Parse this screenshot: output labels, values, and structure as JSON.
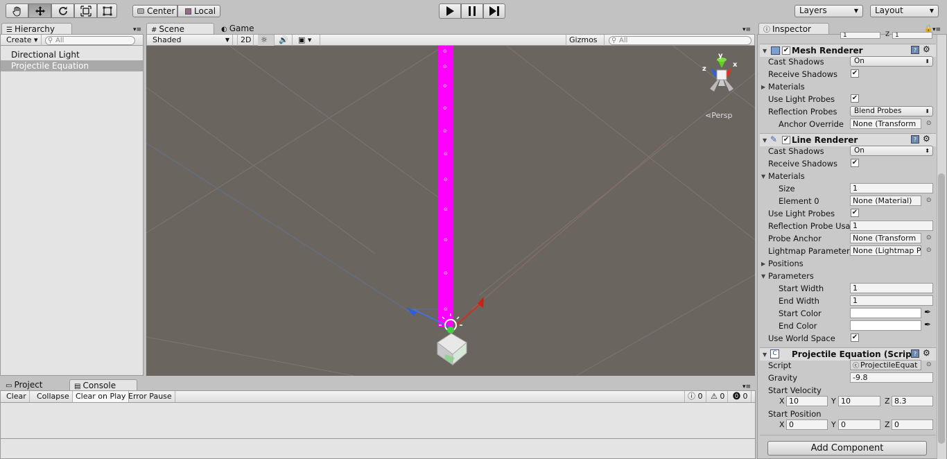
{
  "toolbar": {
    "pivot": "Center",
    "space": "Local",
    "layers": "Layers",
    "layout": "Layout"
  },
  "hierarchy": {
    "tab": "Hierarchy",
    "create": "Create",
    "search_placeholder": "All",
    "items": [
      "Directional Light",
      "Projectile Equation"
    ]
  },
  "scene": {
    "tab_scene": "Scene",
    "tab_game": "Game",
    "shaded": "Shaded",
    "mode_2d": "2D",
    "gizmos": "Gizmos",
    "search_placeholder": "All",
    "persp": "Persp",
    "axis_x": "x",
    "axis_y": "y",
    "axis_z": "z"
  },
  "console": {
    "tab_project": "Project",
    "tab_console": "Console",
    "clear": "Clear",
    "collapse": "Collapse",
    "clear_on_play": "Clear on Play",
    "error_pause": "Error Pause",
    "count_log": "0",
    "count_warn": "0",
    "count_err": "0"
  },
  "inspector": {
    "tab": "Inspector",
    "top_partial": {
      "f1": "1",
      "z_label": "Z",
      "f2": "1"
    },
    "mesh_renderer": {
      "title": "Mesh Renderer",
      "cast_shadows": "Cast Shadows",
      "cast_shadows_value": "On",
      "receive_shadows": "Receive Shadows",
      "materials": "Materials",
      "use_light_probes": "Use Light Probes",
      "reflection_probes": "Reflection Probes",
      "reflection_probes_value": "Blend Probes",
      "anchor_override": "Anchor Override",
      "anchor_override_value": "None (Transform"
    },
    "line_renderer": {
      "title": "Line Renderer",
      "cast_shadows": "Cast Shadows",
      "cast_shadows_value": "On",
      "receive_shadows": "Receive Shadows",
      "materials": "Materials",
      "size": "Size",
      "size_value": "1",
      "element0": "Element 0",
      "element0_value": "None (Material)",
      "use_light_probes": "Use Light Probes",
      "reflection_probe_usage": "Reflection Probe Usa",
      "reflection_probe_usage_value": "1",
      "probe_anchor": "Probe Anchor",
      "probe_anchor_value": "None (Transform",
      "lightmap_parameters": "Lightmap Parameter",
      "lightmap_parameters_value": "None (Lightmap P",
      "positions": "Positions",
      "parameters": "Parameters",
      "start_width": "Start Width",
      "start_width_value": "1",
      "end_width": "End Width",
      "end_width_value": "1",
      "start_color": "Start Color",
      "end_color": "End Color",
      "use_world_space": "Use World Space"
    },
    "projectile": {
      "title": "Projectile Equation (Script",
      "script": "Script",
      "script_value": "ProjectileEquat",
      "gravity": "Gravity",
      "gravity_value": "-9.8",
      "start_velocity": "Start Velocity",
      "start_position": "Start Position",
      "x": "X",
      "y": "Y",
      "z": "Z",
      "vx": "10",
      "vy": "10",
      "vz": "8.3",
      "px": "0",
      "py": "0",
      "pz": "0"
    },
    "add_component": "Add Component"
  },
  "colors": {
    "scene_bg": "#6b6560",
    "line": "#ff00ff",
    "selection": "#a9a9a9"
  }
}
